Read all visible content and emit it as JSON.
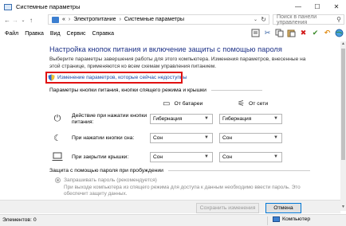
{
  "window": {
    "title": "Системные параметры",
    "controls": {
      "minimize": "—",
      "maximize": "☐",
      "close": "✕"
    }
  },
  "address": {
    "back": "←",
    "forward": "→",
    "recent": "⌄",
    "up": "↑",
    "more": "«",
    "crumbs": [
      "Электропитание",
      "Системные параметры"
    ],
    "crumb_sep": "›",
    "search_placeholder": "Поиск в панели управления"
  },
  "menu": {
    "items": [
      "Файл",
      "Правка",
      "Вид",
      "Сервис",
      "Справка"
    ]
  },
  "toolbar": {
    "icons": [
      "properties-icon",
      "cut-icon",
      "copy-icon",
      "paste-icon",
      "delete-icon",
      "check-icon",
      "undo-icon",
      "globe-icon"
    ]
  },
  "main": {
    "title": "Настройка кнопок питания и включение защиты с помощью пароля",
    "description": "Выберите параметры завершения работы для этого компьютера. Изменения параметров, внесенные на этой странице, применяются ко всем схемам управления питанием.",
    "change_link": "Изменение параметров, которые сейчас недоступны",
    "buttons_section": "Параметры кнопки питания, кнопки спящего режима и крышки",
    "col_battery": "От батареи",
    "col_power": "От сети",
    "rows": [
      {
        "label_line1": "Действие при нажатии кнопки",
        "label_line2": "питания:",
        "battery": "Гибернация",
        "power": "Гибернация"
      },
      {
        "label_line1": "При нажатии кнопки сна:",
        "label_line2": "",
        "battery": "Сон",
        "power": "Сон"
      },
      {
        "label_line1": "При закрытии крышки:",
        "label_line2": "",
        "battery": "Сон",
        "power": "Сон"
      }
    ],
    "password_section": "Защита с помощью пароля при пробуждении",
    "password_option": "Запрашивать пароль (рекомендуется)",
    "password_desc": "При выходе компьютера из спящего режима для доступа к данным необходимо ввести пароль. Это обеспечит защиту данных."
  },
  "buttons": {
    "save": "Сохранить изменения",
    "cancel": "Отмена"
  },
  "status": {
    "items": "Элементов: 0",
    "location": "Компьютер"
  },
  "colors": {
    "title_blue": "#1e3287",
    "link_blue": "#1a4aa8",
    "highlight_red": "#e01010"
  }
}
